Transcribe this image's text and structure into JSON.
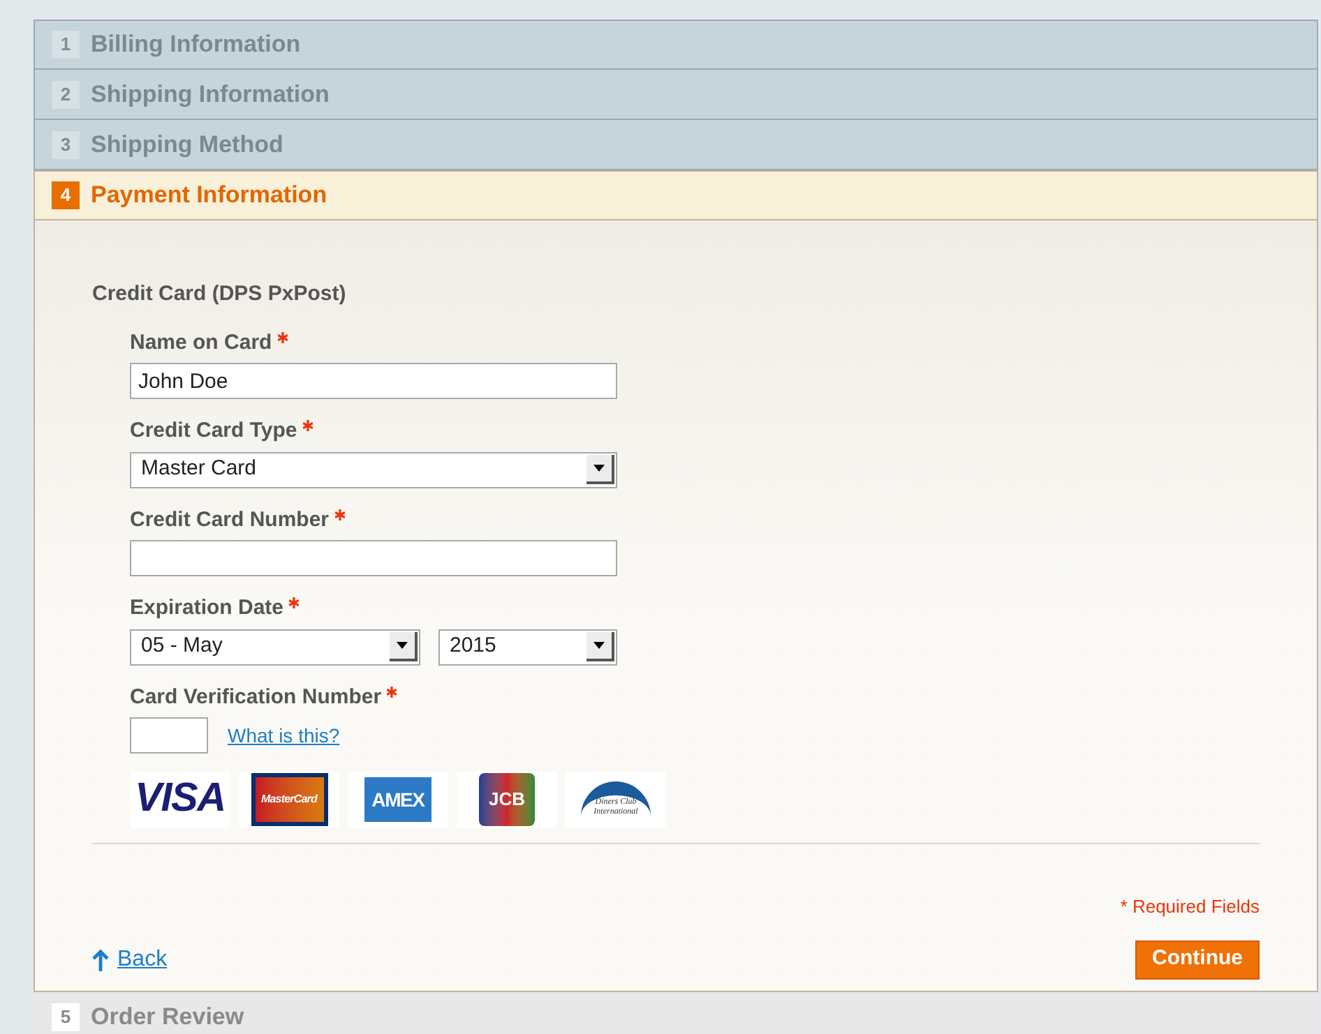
{
  "steps": [
    {
      "number": "1",
      "title": "Billing Information",
      "selected": false,
      "disabled": false
    },
    {
      "number": "2",
      "title": "Shipping Information",
      "selected": false,
      "disabled": false
    },
    {
      "number": "3",
      "title": "Shipping Method",
      "selected": false,
      "disabled": false
    },
    {
      "number": "4",
      "title": "Payment Information",
      "selected": true,
      "disabled": false
    },
    {
      "number": "5",
      "title": "Order Review",
      "selected": false,
      "disabled": true
    }
  ],
  "payment": {
    "method": "Credit Card (DPS PxPost)",
    "fields": [
      {
        "kind": "text",
        "label": "Name on Card",
        "required": true,
        "value": "John Doe"
      },
      {
        "kind": "select",
        "label": "Credit Card Type",
        "required": true,
        "value": "Master Card"
      },
      {
        "kind": "text",
        "label": "Credit Card Number",
        "required": true
      },
      {
        "kind": "date",
        "label": "Expiration Date",
        "required": true,
        "month": "05 - May",
        "year": "2015"
      },
      {
        "kind": "cvv",
        "label": "Card Verification Number",
        "required": true,
        "link": "What is this?"
      }
    ],
    "cards": [
      {
        "kind": "visa",
        "text": "VISA"
      },
      {
        "kind": "mastercard",
        "text": "MasterCard"
      },
      {
        "kind": "amex",
        "text": "AMEX"
      },
      {
        "kind": "jcb",
        "text": "JCB"
      },
      {
        "kind": "diners",
        "text": "Diners Club International"
      }
    ],
    "required_note": "* Required Fields",
    "back": "Back",
    "continue": "Continue"
  }
}
